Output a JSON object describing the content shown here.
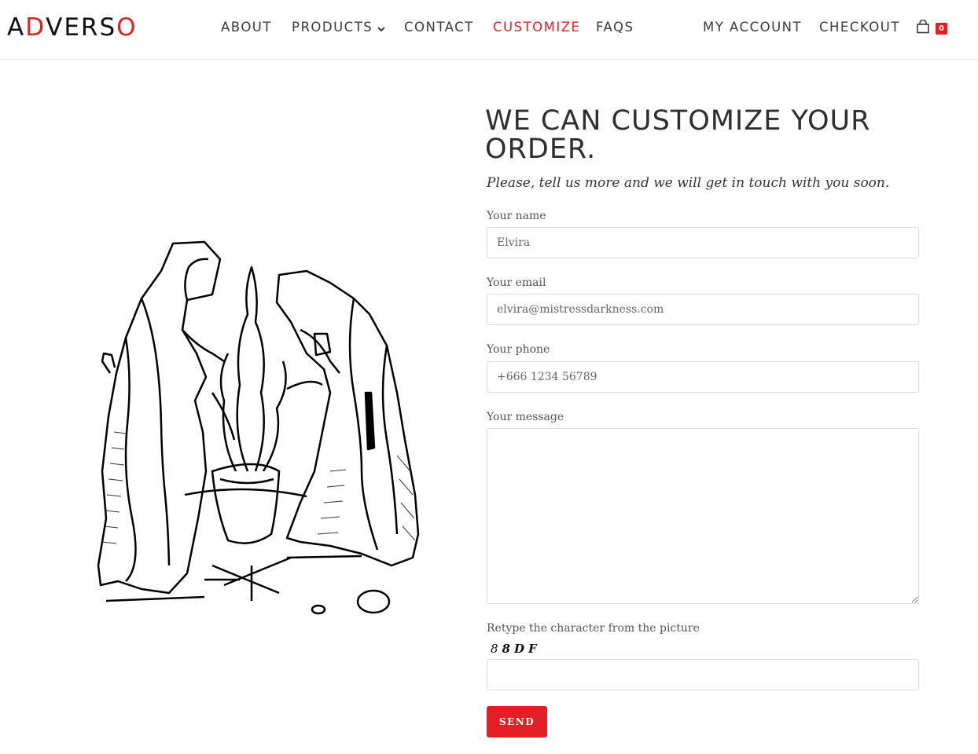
{
  "brand": {
    "logo_letters": [
      "A",
      "D",
      "V",
      "E",
      "R",
      "S",
      "O"
    ]
  },
  "nav": {
    "about": "ABOUT",
    "products": "PRODUCTS",
    "contact": "CONTACT",
    "customize": "CUSTOMIZE",
    "faqs": "FAQS",
    "my_account": "MY ACCOUNT",
    "checkout": "CHECKOUT"
  },
  "cart": {
    "count": "0",
    "icon": "shopping-bag-icon"
  },
  "main": {
    "heading": "WE CAN CUSTOMIZE YOUR ORDER.",
    "subheading": "Please, tell us more and we will get in touch with you soon."
  },
  "form": {
    "name_label": "Your name",
    "name_value": "Elvira",
    "email_label": "Your email",
    "email_value": "elvira@mistressdarkness.com",
    "phone_label": "Your phone",
    "phone_value": "+666 1234 56789",
    "message_label": "Your message",
    "message_value": "",
    "captcha_label": "Retype the character from the picture",
    "captcha_chars": [
      "8",
      "8",
      "D",
      "F"
    ],
    "captcha_value": "",
    "send_label": "SEND"
  },
  "colors": {
    "accent": "#e31e24",
    "text": "#333333",
    "border": "#dcdcdc"
  }
}
